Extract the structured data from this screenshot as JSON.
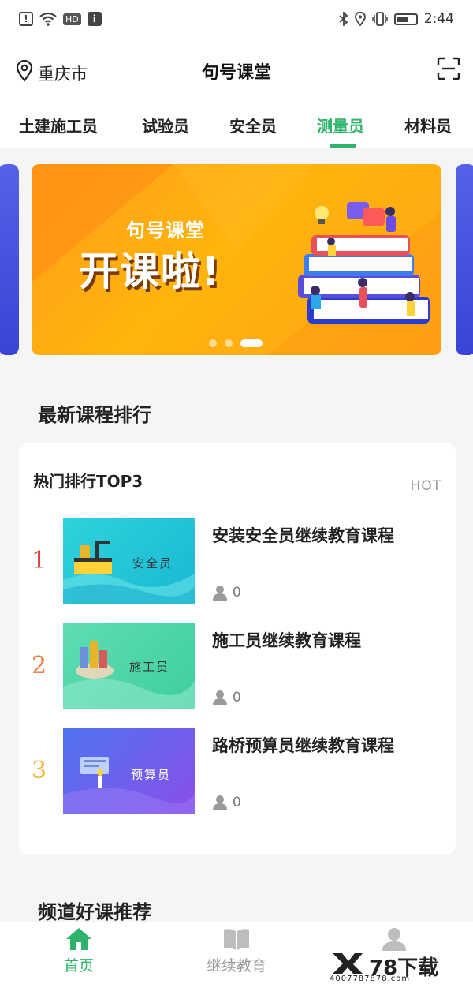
{
  "status_bar": {
    "time": "2:44",
    "left_icons": [
      "alert-icon",
      "wifi-icon",
      "hd-icon",
      "info-icon"
    ],
    "right_icons": [
      "bluetooth-icon",
      "location-icon",
      "vibrate-icon",
      "battery-icon"
    ]
  },
  "header": {
    "location": "重庆市",
    "title": "句号课堂",
    "scan_icon": "scan-icon"
  },
  "tabs": [
    {
      "label": "土建施工员",
      "active": false
    },
    {
      "label": "试验员",
      "active": false
    },
    {
      "label": "安全员",
      "active": false
    },
    {
      "label": "测量员",
      "active": true
    },
    {
      "label": "材料员",
      "active": false
    }
  ],
  "banner": {
    "subtitle": "句号课堂",
    "headline": "开课啦!",
    "slide_count": 3,
    "active_slide": 3
  },
  "section_latest": {
    "title": "最新课程排行"
  },
  "ranking": {
    "title": "热门排行TOP3",
    "hot_label": "HOT",
    "items": [
      {
        "rank": "1",
        "title": "安装安全员继续教育课程",
        "thumb_label": "安全员",
        "views": "0",
        "rank_color": "#e0423a"
      },
      {
        "rank": "2",
        "title": "施工员继续教育课程",
        "thumb_label": "施工员",
        "views": "0",
        "rank_color": "#f07a3b"
      },
      {
        "rank": "3",
        "title": "路桥预算员继续教育课程",
        "thumb_label": "预算员",
        "views": "0",
        "rank_color": "#f0b83b"
      }
    ]
  },
  "section_channel": {
    "title": "频道好课推荐"
  },
  "bottom_nav": [
    {
      "label": "首页",
      "icon": "home-icon",
      "active": true
    },
    {
      "label": "继续教育",
      "icon": "book-icon",
      "active": false
    },
    {
      "label": "",
      "icon": "user-icon",
      "active": false
    }
  ],
  "watermark": {
    "brand": "78下载",
    "domain": "4007787878.com"
  },
  "colors": {
    "accent": "#2db36a",
    "background": "#f5f5f5"
  }
}
